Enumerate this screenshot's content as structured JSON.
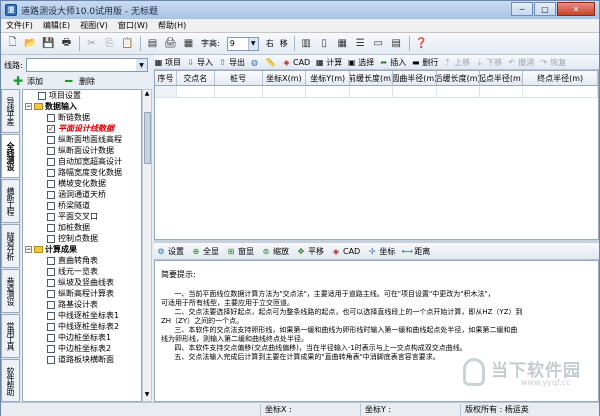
{
  "window": {
    "title": "道路测设大师10.0试用版 - 无标题",
    "app_icon": "road-icon",
    "buttons": [
      "─",
      "□",
      "✕"
    ]
  },
  "menu": [
    "文件(F)",
    "编辑(E)",
    "视图(V)",
    "窗口(W)",
    "帮助(H)"
  ],
  "toolbar": {
    "font_label": "字高:",
    "font_value": "9",
    "btn_right": "右",
    "btn_move": "移"
  },
  "left": {
    "line_label": "线路:",
    "line_value": "",
    "add_label": "添加",
    "delete_label": "删除",
    "vtabs": [
      "导线平差",
      "全线测设",
      "横断工程",
      "隧道分析",
      "巷道测设",
      "常用工具",
      "软件帮助"
    ],
    "tree": [
      {
        "text": "项目设置",
        "kind": "item",
        "level": 1
      },
      {
        "text": "数据输入",
        "kind": "group",
        "level": 0
      },
      {
        "text": "断链数据",
        "kind": "item",
        "level": 1
      },
      {
        "text": "平面设计线数据",
        "kind": "checked",
        "level": 1
      },
      {
        "text": "纵断面地面线高程",
        "kind": "item",
        "level": 1
      },
      {
        "text": "纵断面设计数据",
        "kind": "item",
        "level": 1
      },
      {
        "text": "自动加宽超高设计",
        "kind": "item",
        "level": 1
      },
      {
        "text": "路幅宽度变化数据",
        "kind": "item",
        "level": 1
      },
      {
        "text": "横坡变化数据",
        "kind": "item",
        "level": 1
      },
      {
        "text": "涵洞通道天桥",
        "kind": "item",
        "level": 1
      },
      {
        "text": "桥梁隧道",
        "kind": "item",
        "level": 1
      },
      {
        "text": "平面交叉口",
        "kind": "item",
        "level": 1
      },
      {
        "text": "加桩数据",
        "kind": "item",
        "level": 1
      },
      {
        "text": "控制点数据",
        "kind": "item",
        "level": 1
      },
      {
        "text": "计算成果",
        "kind": "group",
        "level": 0
      },
      {
        "text": "直曲转角表",
        "kind": "item",
        "level": 1
      },
      {
        "text": "线元一览表",
        "kind": "item",
        "level": 1
      },
      {
        "text": "纵坡及竖曲线表",
        "kind": "item",
        "level": 1
      },
      {
        "text": "纵断高程计算表",
        "kind": "item",
        "level": 1
      },
      {
        "text": "路基设计表",
        "kind": "item",
        "level": 1
      },
      {
        "text": "中线逐桩坐标表1",
        "kind": "item",
        "level": 1
      },
      {
        "text": "中线逐桩坐标表2",
        "kind": "item",
        "level": 1
      },
      {
        "text": "中边桩坐标表1",
        "kind": "item",
        "level": 1
      },
      {
        "text": "中边桩坐标表2",
        "kind": "item",
        "level": 1
      },
      {
        "text": "道路板块横断面",
        "kind": "item",
        "level": 1
      }
    ]
  },
  "right_toolbar": {
    "items": [
      {
        "icon": "project-icon",
        "label": "项目"
      },
      {
        "icon": "import-icon",
        "label": "导入"
      },
      {
        "icon": "export-icon",
        "label": "导出"
      },
      {
        "icon": "globe-icon",
        "label": ""
      },
      {
        "icon": "ruler-icon",
        "label": ""
      },
      {
        "icon": "cad-icon",
        "label": "CAD"
      },
      {
        "icon": "grid-icon",
        "label": "计算"
      },
      {
        "icon": "select-icon",
        "label": "选择"
      },
      {
        "icon": "insert-icon",
        "label": "插入"
      },
      {
        "icon": "delete-row-icon",
        "label": "删行"
      },
      {
        "icon": "move-up-icon",
        "label": "上移",
        "disabled": true
      },
      {
        "icon": "move-down-icon",
        "label": "下移",
        "disabled": true
      },
      {
        "icon": "undo-icon",
        "label": "撤消",
        "disabled": true
      },
      {
        "icon": "redo-icon",
        "label": "恢复",
        "disabled": true
      }
    ]
  },
  "table": {
    "headers": [
      "序号",
      "交点名",
      "桩号",
      "坐标X(m)",
      "坐标Y(m)",
      "前缓长度(m)",
      "圆曲半径(m)",
      "后缓长度(m)",
      "起点半径(m)",
      "终点半径(m)"
    ]
  },
  "graph_toolbar": {
    "items": [
      {
        "icon": "settings-icon",
        "label": "设置"
      },
      {
        "icon": "fit-all-icon",
        "label": "全显"
      },
      {
        "icon": "window-icon",
        "label": "窗显"
      },
      {
        "icon": "zoom-icon",
        "label": "缩放"
      },
      {
        "icon": "pan-icon",
        "label": "平移"
      },
      {
        "icon": "cad-icon",
        "label": "CAD"
      },
      {
        "icon": "coordinate-icon",
        "label": "坐标"
      },
      {
        "icon": "distance-icon",
        "label": "距离"
      }
    ]
  },
  "help": {
    "title": "简要提示:",
    "body": "      一、当前平面线位数据计算方法为\"交点法\"，主要适用于道路主线。可在\"项目设置\"中更改为\"积木法\"，\n可适用于所有线型，主要应用于立交匝道。\n      二、交点法要选择好起点，起点可为整条线路的起点，也可以选择直线段上的一个点开始计算，即从HZ（YZ）到\nZH（ZY）之间的一个点。\n      三、本软件的交点法支持卵形线，如果第一缓和曲线为卵形线时输入第一缓和曲线起点处半径，如果第二缓和曲\n线为卵形线，则输入第二缓和曲线终点处半径。\n      四、本软件支持交点偏移(交点曲线偏移)，当在半径输入-1时表示与上一交点构成双交点曲线。\n      五、交点法输入完成后计算到主要在计算成果的\"直曲转角表\"中消脚底表言容言要求。"
  },
  "status": {
    "x_label": "坐标X :",
    "y_label": "坐标Y :",
    "copyright": "版权所有 : 杨运英"
  },
  "watermark": {
    "line1": "当下软件园",
    "line2": "www.yyqf.cc"
  }
}
